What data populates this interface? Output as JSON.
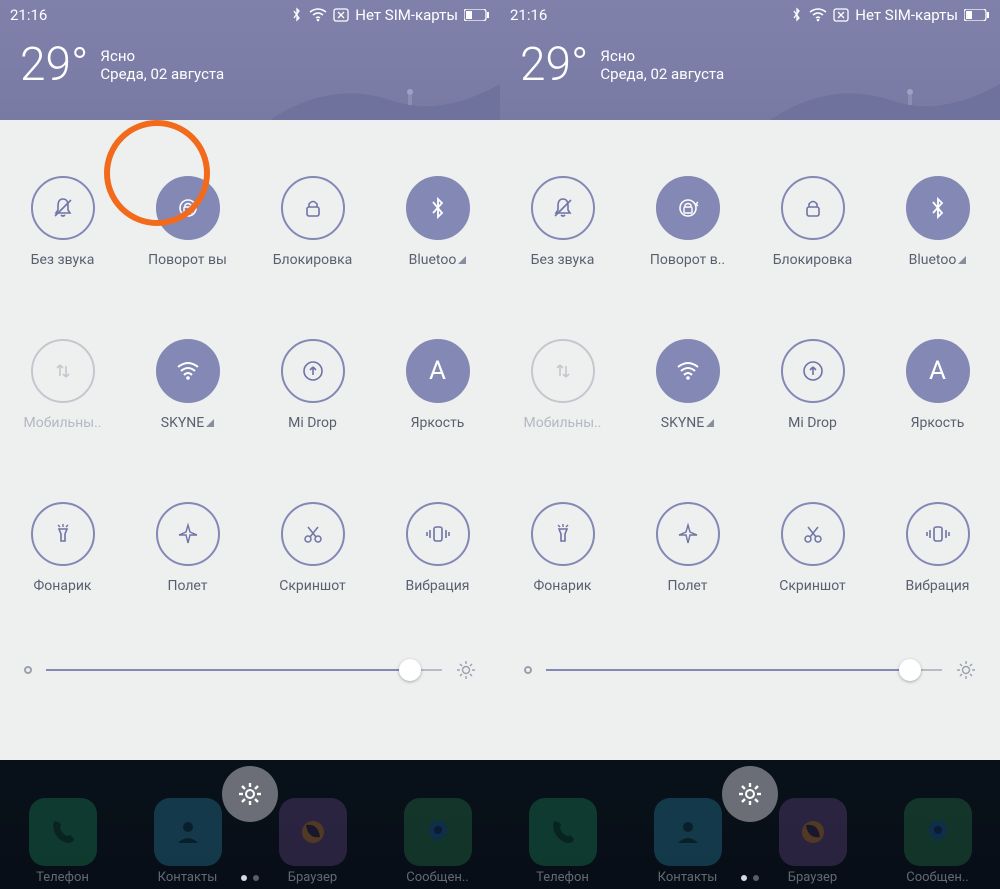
{
  "status": {
    "time": "21:16",
    "sim": "Нет SIM-карты"
  },
  "weather": {
    "temp": "29°",
    "cond": "Ясно",
    "date": "Среда, 02 августа"
  },
  "tiles": {
    "mute": {
      "label": "Без звука"
    },
    "rotate": {
      "label": "Поворот вы"
    },
    "rotate2": {
      "label": "Поворот в.."
    },
    "lock": {
      "label": "Блокировка"
    },
    "bt": {
      "label": "Bluetoo"
    },
    "data": {
      "label": "Мобильны.."
    },
    "wifi": {
      "label": "SKYNE"
    },
    "midrop": {
      "label": "Mi Drop"
    },
    "bright": {
      "label": "Яркость"
    },
    "torch": {
      "label": "Фонарик"
    },
    "plane": {
      "label": "Полет"
    },
    "shot": {
      "label": "Скриншот"
    },
    "vibe": {
      "label": "Вибрация"
    }
  },
  "brightness_pct": 92,
  "dock": {
    "phone": "Телефон",
    "contacts": "Контакты",
    "browser": "Браузер",
    "msg": "Сообщен.."
  },
  "colors": {
    "accent": "#8488b5",
    "highlight": "#f26b1d"
  }
}
